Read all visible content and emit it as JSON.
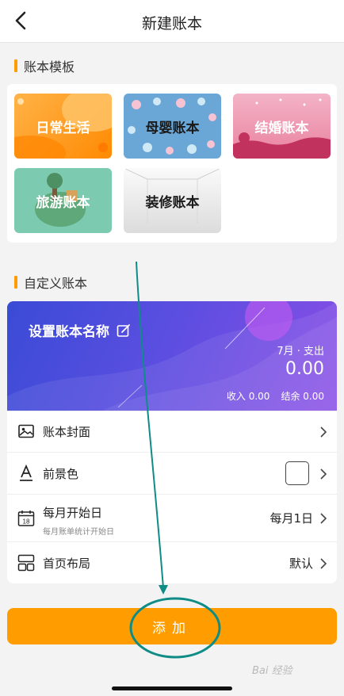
{
  "header": {
    "title": "新建账本"
  },
  "templates_section": {
    "title": "账本模板",
    "items": [
      {
        "label": "日常生活"
      },
      {
        "label": "母婴账本"
      },
      {
        "label": "结婚账本"
      },
      {
        "label": "旅游账本"
      },
      {
        "label": "装修账本"
      }
    ]
  },
  "custom_section": {
    "title": "自定义账本",
    "banner": {
      "name": "设置账本名称",
      "month_label": "7月 · 支出",
      "amount": "0.00",
      "income_label": "收入 0.00",
      "balance_label": "结余 0.00"
    },
    "rows": [
      {
        "label": "账本封面",
        "icon": "image-icon"
      },
      {
        "label": "前景色",
        "icon": "font-color-icon"
      },
      {
        "label": "每月开始日",
        "hint": "每月账单统计开始日",
        "value": "每月1日",
        "icon": "calendar-icon"
      },
      {
        "label": "首页布局",
        "value": "默认",
        "icon": "layout-icon"
      }
    ]
  },
  "add_button": {
    "label": "添加"
  },
  "watermark": "Bai 经验",
  "colors": {
    "accent": "#ff9d00",
    "annotation": "#0f8c86"
  }
}
